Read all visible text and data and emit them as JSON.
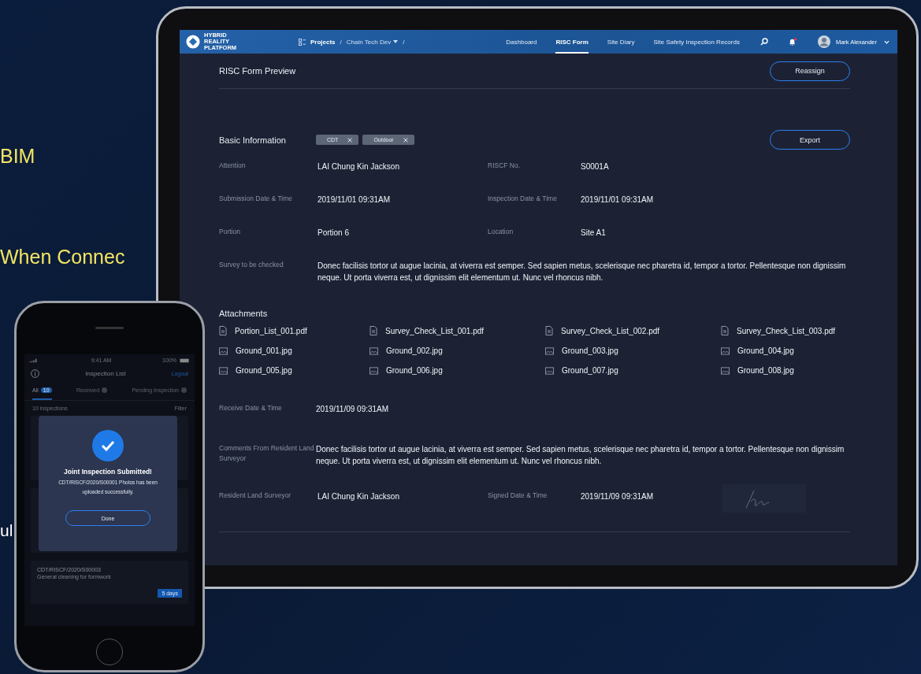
{
  "slide_text": [
    {
      "text": "BIM",
      "kind": "highlight"
    },
    {
      "text": "When Connec",
      "kind": "highlight"
    },
    {
      "text": "ul",
      "kind": "plain"
    }
  ],
  "tablet": {
    "nav": {
      "logo": "HYBRID REALITY PLATFORM",
      "breadcrumb": [
        {
          "kind": "link",
          "label": "Projects"
        },
        {
          "kind": "sep",
          "label": "/"
        },
        {
          "kind": "dropdown",
          "label": "Chain Tech Dev"
        },
        {
          "kind": "sep",
          "label": "/"
        }
      ],
      "tabs": [
        {
          "label": "Dashboard",
          "selected": false
        },
        {
          "label": "RISC Form",
          "selected": true
        },
        {
          "label": "Site Diary",
          "selected": false
        },
        {
          "label": "Site Safety Inspection Records",
          "selected": false
        }
      ],
      "has_notification": true,
      "user": "Mark Alexander"
    },
    "title": "RISC Form Preview",
    "reassign": "Reassign",
    "section": "Basic Information",
    "tags": [
      "CDT",
      "Outdoor"
    ],
    "export": "Export",
    "fields": [
      {
        "label": "Attention",
        "value": "LAI Chung Kin Jackson"
      },
      {
        "label": "RISCF No.",
        "value": "S0001A"
      },
      {
        "label": "Submission Date & Time",
        "value": "2019/11/01 09:31AM"
      },
      {
        "label": "Inspection Date & Time",
        "value": "2019/11/01 09:31AM"
      },
      {
        "label": "Portion",
        "value": "Portion 6"
      },
      {
        "label": "Location",
        "value": "Site A1"
      }
    ],
    "survey": {
      "label": "Survey to be checked",
      "value": "Donec facilisis tortor ut augue lacinia, at viverra est semper. Sed sapien metus, scelerisque nec pharetra id, tempor a tortor. Pellentesque non dignissim neque. Ut porta viverra est, ut dignissim elit elementum ut. Nunc vel rhoncus nibh."
    },
    "attachments_title": "Attachments",
    "attachments": [
      {
        "name": "Portion_List_001.pdf",
        "kind": "pdf"
      },
      {
        "name": "Survey_Check_List_001.pdf",
        "kind": "pdf"
      },
      {
        "name": "Survey_Check_List_002.pdf",
        "kind": "pdf"
      },
      {
        "name": "Survey_Check_List_003.pdf",
        "kind": "pdf"
      },
      {
        "name": "Ground_001.jpg",
        "kind": "image"
      },
      {
        "name": "Ground_002.jpg",
        "kind": "image"
      },
      {
        "name": "Ground_003.jpg",
        "kind": "image"
      },
      {
        "name": "Ground_004.jpg",
        "kind": "image"
      },
      {
        "name": "Ground_005.jpg",
        "kind": "image"
      },
      {
        "name": "Ground_006.jpg",
        "kind": "image"
      },
      {
        "name": "Ground_007.jpg",
        "kind": "image"
      },
      {
        "name": "Ground_008.jpg",
        "kind": "image"
      }
    ],
    "receive": {
      "label": "Receive Date & Time",
      "value": "2019/11/09 09:31AM"
    },
    "comments": {
      "label": "Comments From Resident Land Surveyor",
      "value": "Donec facilisis tortor ut augue lacinia, at viverra est semper. Sed sapien metus, scelerisque nec pharetra id, tempor a tortor. Pellentesque non dignissim neque. Ut porta viverra est, ut dignissim elit elementum ut. Nunc vel rhoncus nibh."
    },
    "surveyor": {
      "label": "Resident Land Surveyor",
      "value": "LAI Chung Kin Jackson"
    },
    "signed": {
      "label": "Signed Date & Time",
      "value": "2019/11/09 09:31AM"
    }
  },
  "phone": {
    "time": "9:41 AM",
    "battery": "100%",
    "title": "Inspection List",
    "logout": "Logout",
    "tabs": [
      {
        "label": "All",
        "count": "10",
        "selected": true
      },
      {
        "label": "Received",
        "selected": false
      },
      {
        "label": "Pending Inspection",
        "selected": false
      }
    ],
    "count_text": "10 inspections",
    "filter": "Filter",
    "cards": [
      {
        "code": "CDT/RISCF/2020/S00003",
        "desc": "General cleaning for formwork",
        "badge": "5 days"
      }
    ],
    "modal": {
      "title": "Joint Inspection Submitted!",
      "message": "CDT/RISCF/2020/S00001 Photos has been uploaded successfully.",
      "button": "Done"
    }
  }
}
